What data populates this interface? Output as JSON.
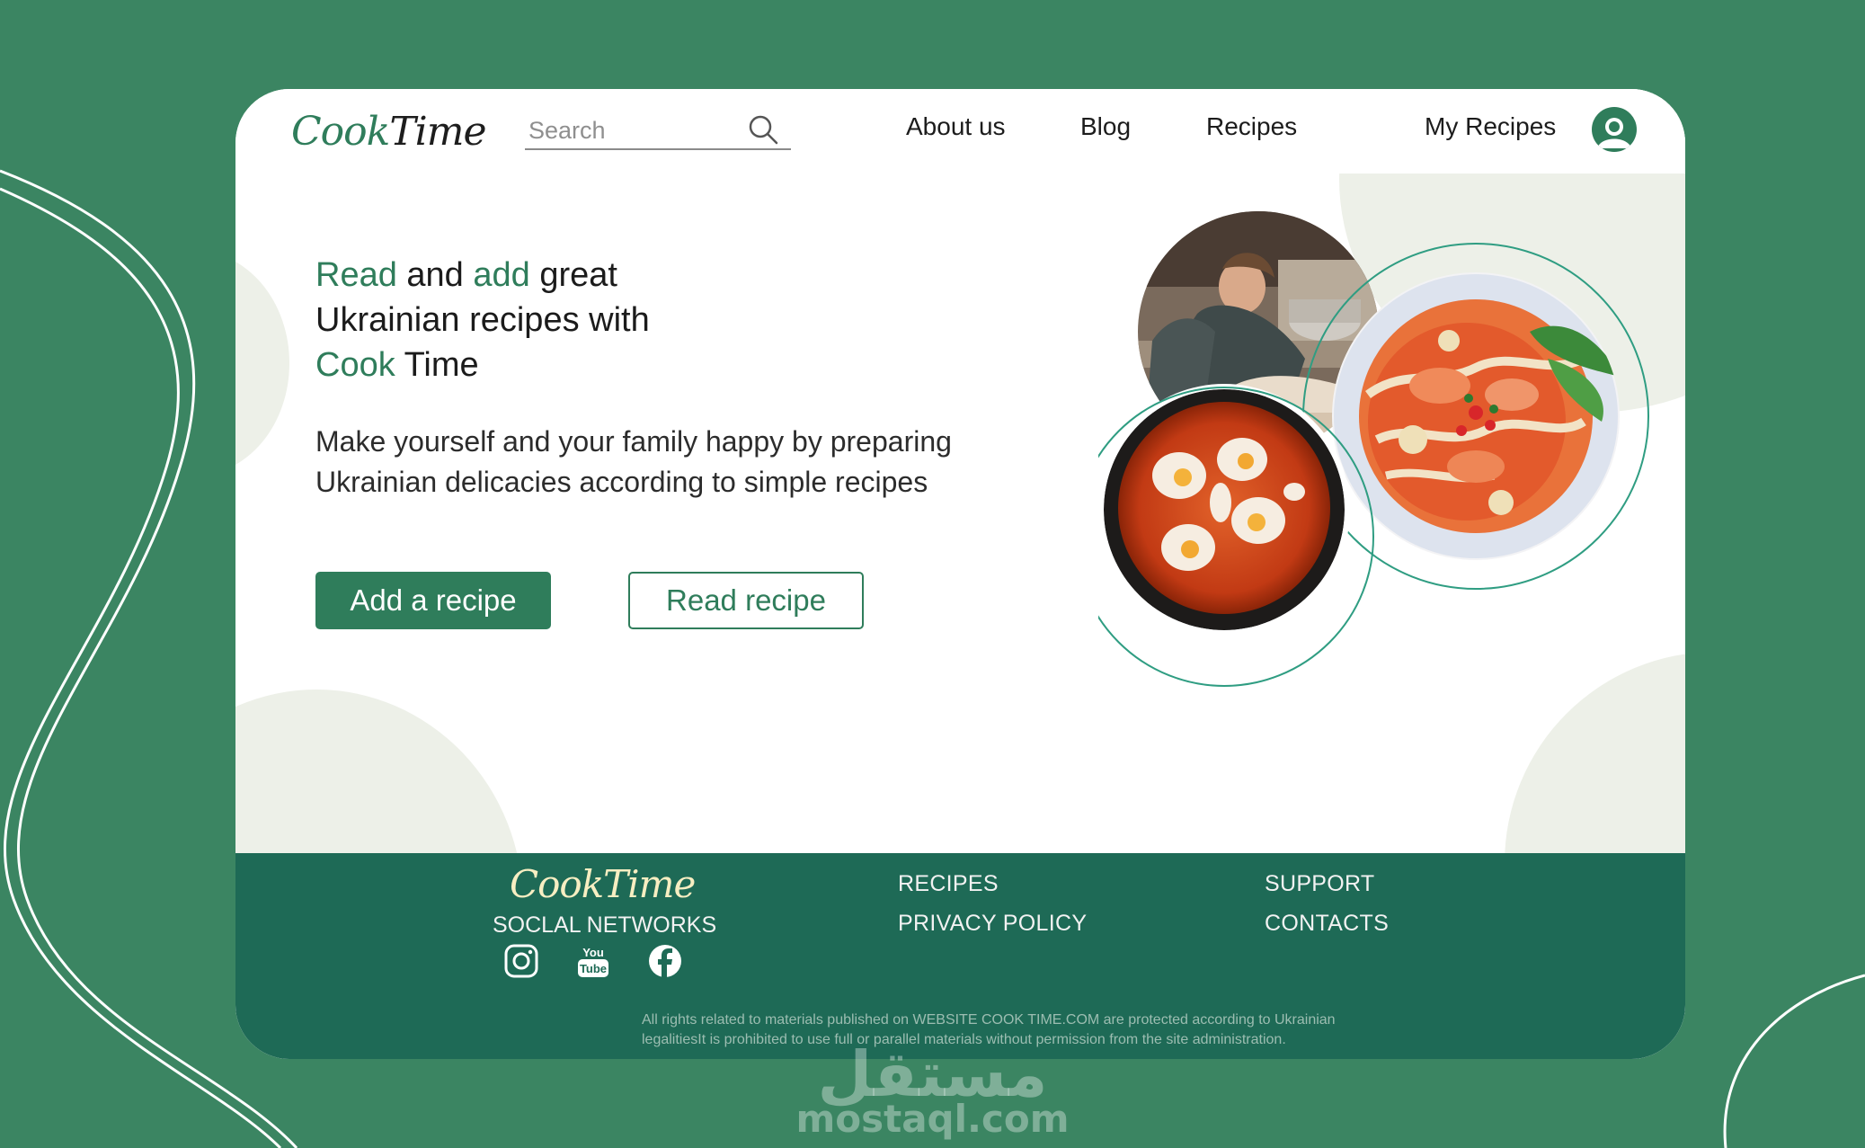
{
  "header": {
    "logo_part1": "Cook",
    "logo_part2": "Time",
    "search_placeholder": "Search",
    "nav": {
      "about": "About us",
      "blog": "Blog",
      "recipes": "Recipes",
      "my_recipes": "My Recipes"
    }
  },
  "hero": {
    "title_read": "Read",
    "title_and": " and ",
    "title_add": "add",
    "title_great": " great",
    "title_line2": "Ukrainian recipes with",
    "title_cook": "Cook",
    "title_time": " Time",
    "description": "Make yourself and your family happy by preparing Ukrainian delicacies according to simple recipes",
    "add_button": "Add a recipe",
    "read_button": "Read recipe"
  },
  "footer": {
    "logo_part1": "Cook",
    "logo_part2": "Time",
    "social_title": "SOCLAL NETWORKS",
    "links": {
      "recipes": "RECIPES",
      "privacy": "PRIVACY POLICY",
      "support": "SUPPORT",
      "contacts": "CONTACTS"
    },
    "youtube_top": "You",
    "youtube_bottom": "Tube",
    "copyright_line1": "All rights related to materials published on WEBSITE COOK TIME.COM are protected according to Ukrainian",
    "copyright_line2": "legalitiesIt is prohibited to use full or parallel materials without permission from the site administration."
  },
  "watermark": {
    "arabic": "مستقل",
    "latin": "mostaql.com"
  },
  "colors": {
    "brand_green": "#2f7d5b",
    "footer_green": "#1e6a56",
    "background": "#3b8562",
    "blob": "#edf0e8"
  }
}
